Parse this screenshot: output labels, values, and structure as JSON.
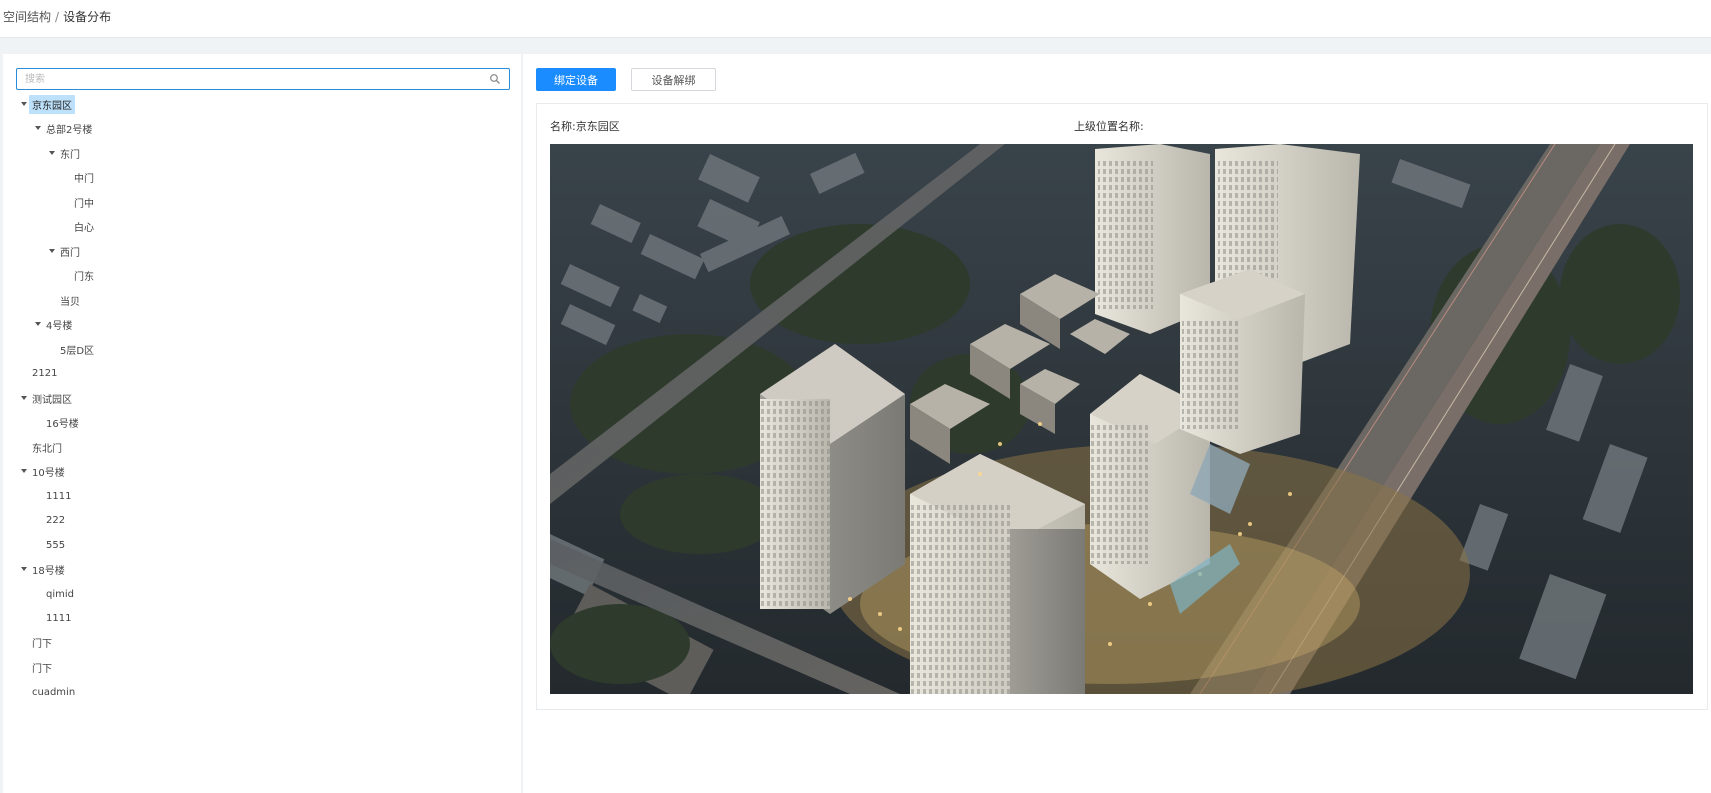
{
  "breadcrumb": {
    "parent": "空间结构",
    "separator": "/",
    "current": "设备分布"
  },
  "search": {
    "placeholder": "搜索",
    "value": ""
  },
  "tree": [
    {
      "label": "京东园区",
      "expanded": true,
      "selected": true
    },
    {
      "label": "总部2号楼",
      "expanded": true
    },
    {
      "label": "东门",
      "expanded": true
    },
    {
      "label": "中门"
    },
    {
      "label": "门中"
    },
    {
      "label": "白心"
    },
    {
      "label": "西门",
      "expanded": true
    },
    {
      "label": "门东"
    },
    {
      "label": "当贝"
    },
    {
      "label": "4号楼",
      "expanded": true
    },
    {
      "label": "5层D区"
    },
    {
      "label": "2121"
    },
    {
      "label": "测试园区",
      "expanded": true
    },
    {
      "label": "16号楼"
    },
    {
      "label": "东北门"
    },
    {
      "label": "10号楼",
      "expanded": true
    },
    {
      "label": "1111"
    },
    {
      "label": "222"
    },
    {
      "label": "555"
    },
    {
      "label": "18号楼",
      "expanded": true
    },
    {
      "label": "qimid"
    },
    {
      "label": "1111"
    },
    {
      "label": "门下"
    },
    {
      "label": "门下"
    },
    {
      "label": "cuadmin"
    }
  ],
  "toolbar": {
    "bind_label": "绑定设备",
    "unbind_label": "设备解绑"
  },
  "info": {
    "name_label": "名称:",
    "name_value": "京东园区",
    "parent_label": "上级位置名称:",
    "parent_value": ""
  },
  "colors": {
    "primary": "#1a8cff",
    "selected_bg": "#bde1fb",
    "page_bg": "#f0f3f5"
  }
}
